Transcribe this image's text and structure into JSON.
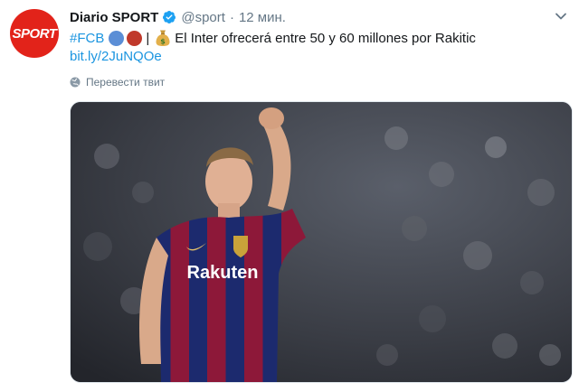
{
  "account": {
    "avatar_text": "SPORT",
    "name": "Diario SPORT",
    "handle": "@sport",
    "separator": "·",
    "time": "12 мин."
  },
  "tweet": {
    "hashtag": "#FCB",
    "divider": "|",
    "text": "El Inter ofrecerá entre 50 y 60 millones por Rakitic",
    "link": "bit.ly/2JuNQOe"
  },
  "actions": {
    "translate_label": "Перевести твит"
  },
  "photo": {
    "shirt_sponsor": "Rakuten"
  },
  "colors": {
    "brand_red": "#e2231a",
    "link_blue": "#1b95e0",
    "secondary_text": "#657786",
    "blue_circle": "#5b8ed6",
    "red_circle": "#c0392b"
  },
  "icons": {
    "verified": "verified-badge-icon",
    "caret": "chevron-down-icon",
    "globe": "globe-icon",
    "moneybag": "money-bag-icon"
  }
}
